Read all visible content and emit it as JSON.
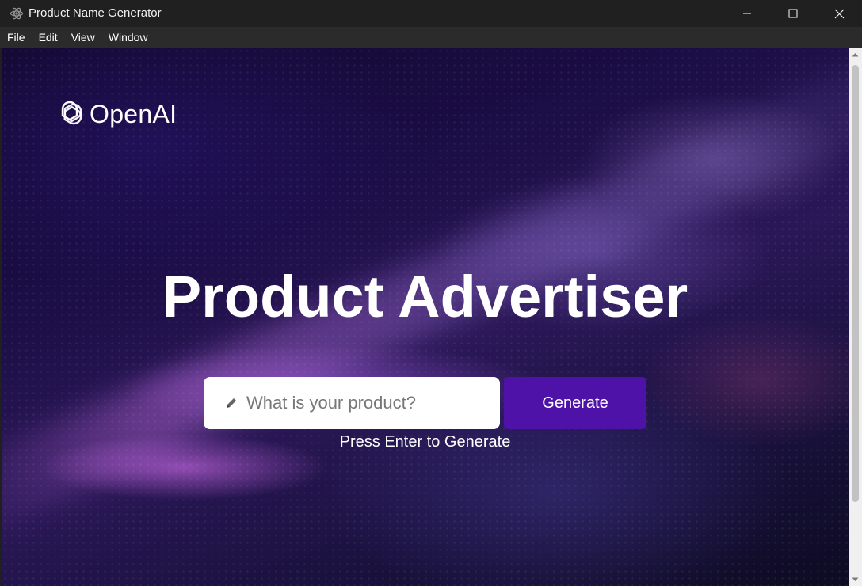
{
  "window": {
    "title": "Product Name Generator"
  },
  "menu": {
    "items": [
      "File",
      "Edit",
      "View",
      "Window"
    ]
  },
  "logo": {
    "text": "OpenAI"
  },
  "hero": {
    "title": "Product Advertiser"
  },
  "form": {
    "placeholder": "What is your product?",
    "value": "",
    "button_label": "Generate",
    "hint": "Press Enter to Generate"
  },
  "colors": {
    "button": "#4e12a8",
    "titlebar": "#202020",
    "menubar": "#2b2b2b"
  },
  "icons": {
    "app": "electron-icon",
    "logo": "openai-logo-icon",
    "input": "pencil-icon"
  }
}
